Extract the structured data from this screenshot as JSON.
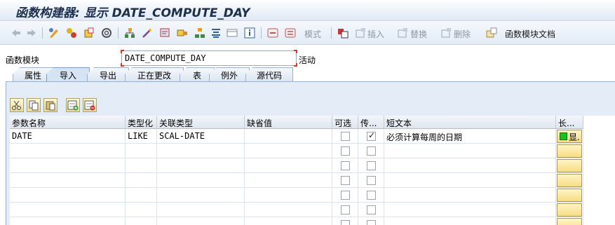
{
  "window": {
    "title": "函数构建器: 显示 DATE_COMPUTE_DAY"
  },
  "toolbar": {
    "mode_label": "模式",
    "insert_label": "插入",
    "replace_label": "替换",
    "delete_label": "删除",
    "docs_label": "函数模块文档"
  },
  "function_module": {
    "label": "函数模块",
    "value": "DATE_COMPUTE_DAY",
    "status": "活动"
  },
  "tabs": [
    {
      "label": "属性"
    },
    {
      "label": "导入"
    },
    {
      "label": "导出"
    },
    {
      "label": "正在更改"
    },
    {
      "label": "表"
    },
    {
      "label": "例外"
    },
    {
      "label": "源代码"
    }
  ],
  "active_tab": "导入",
  "table": {
    "columns": [
      "参数名称",
      "类型化",
      "关联类型",
      "缺省值",
      "可选",
      "传...",
      "短文本",
      "长..."
    ],
    "rows": [
      {
        "name": "DATE",
        "typing": "LIKE",
        "ref_type": "SCAL-DATE",
        "default": "",
        "optional": false,
        "pass_value": true,
        "short_text": "必须计算每周的日期",
        "long_text": "显.",
        "long_text_status_color": "#18c21e"
      }
    ]
  },
  "colors": {
    "accent": "#d6e3f3",
    "title": "#1d2f4d",
    "button_yellow": "#f6dd84"
  }
}
